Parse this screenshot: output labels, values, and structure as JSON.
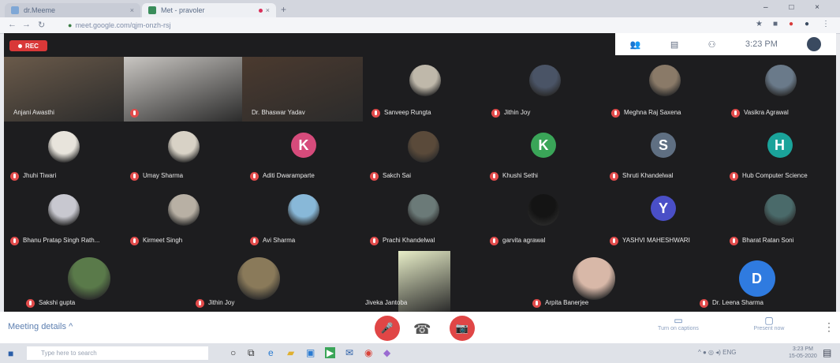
{
  "browser": {
    "tabs": [
      {
        "label": "dr.Meeme",
        "close": "×"
      },
      {
        "label": "Met - pravoler",
        "close": "×"
      }
    ],
    "new_tab": "+",
    "window_controls": "– □ ×",
    "url": "meet.google.com/qjm-onzh-rsj"
  },
  "meet": {
    "rec_label": "REC",
    "clock": "3:23 PM",
    "participants": [
      {
        "name": "Anjani Awasthi"
      },
      {
        "name": ""
      },
      {
        "name": "Dr. Bhaswar Yadav"
      },
      {
        "name": "Sanveep Rungta"
      },
      {
        "name": "Jithin Joy"
      },
      {
        "name": "Meghna Raj Saxena"
      },
      {
        "name": "Vasikra Agrawal"
      },
      {
        "name": "Jhuhi Tiwari"
      },
      {
        "name": "Umay Sharma"
      },
      {
        "name": "Aditi Dwaramparte",
        "initial": "K"
      },
      {
        "name": "Sakch Sai"
      },
      {
        "name": "Khushi Sethi",
        "initial": "K"
      },
      {
        "name": "Shruti Khandelwal",
        "initial": "S"
      },
      {
        "name": "Hub Computer Science",
        "initial": "H"
      },
      {
        "name": "Bhanu Pratap Singh Rath..."
      },
      {
        "name": "Kirmeet Singh"
      },
      {
        "name": "Avi Sharma"
      },
      {
        "name": "Prachi Khandelwal"
      },
      {
        "name": "garvita agrawal"
      },
      {
        "name": "YASHVI MAHESHWARI",
        "initial": "Y"
      },
      {
        "name": "Bharat Ratan Soni"
      },
      {
        "name": "Sakshi gupta"
      },
      {
        "name": "Jithin Joy"
      },
      {
        "name": "Jiveka Jantoba"
      },
      {
        "name": "Arpita Banerjee"
      },
      {
        "name": "Dr. Leena Sharma",
        "initial": "D"
      }
    ]
  },
  "controls": {
    "meeting_details": "Meeting details",
    "chevron": "^",
    "captions_label": "Turn on captions",
    "present_label": "Present now",
    "more": "⋮"
  },
  "taskbar": {
    "search_placeholder": "Type here to search",
    "time": "3:23 PM",
    "date": "15-05-2020"
  },
  "colors": {
    "meet_bg": "#1d1d1f",
    "mic_off": "#e24b4b",
    "end_call": "#e04646"
  }
}
